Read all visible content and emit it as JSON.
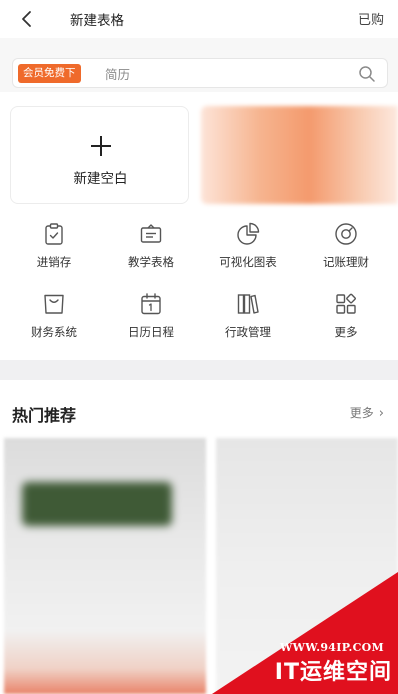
{
  "header": {
    "title": "新建表格",
    "purchased_label": "已购"
  },
  "search": {
    "member_tag": "会员免费下",
    "placeholder": "简历"
  },
  "new_blank": {
    "label": "新建空白"
  },
  "categories": [
    {
      "label": "进销存",
      "icon": "clipboard-check-icon"
    },
    {
      "label": "教学表格",
      "icon": "teaching-board-icon"
    },
    {
      "label": "可视化图表",
      "icon": "pie-chart-icon"
    },
    {
      "label": "记账理财",
      "icon": "coin-icon"
    },
    {
      "label": "财务系统",
      "icon": "shopping-bag-icon"
    },
    {
      "label": "日历日程",
      "icon": "calendar-icon"
    },
    {
      "label": "行政管理",
      "icon": "books-icon"
    },
    {
      "label": "更多",
      "icon": "grid-more-icon"
    }
  ],
  "hot": {
    "title": "热门推荐",
    "more_label": "更多"
  },
  "watermark": {
    "url": "WWW.94IP.COM",
    "name": "IT运维空间"
  },
  "colors": {
    "accent_orange": "#ef6a2b",
    "watermark_red": "#e0101e",
    "icon_gray": "#555555"
  }
}
